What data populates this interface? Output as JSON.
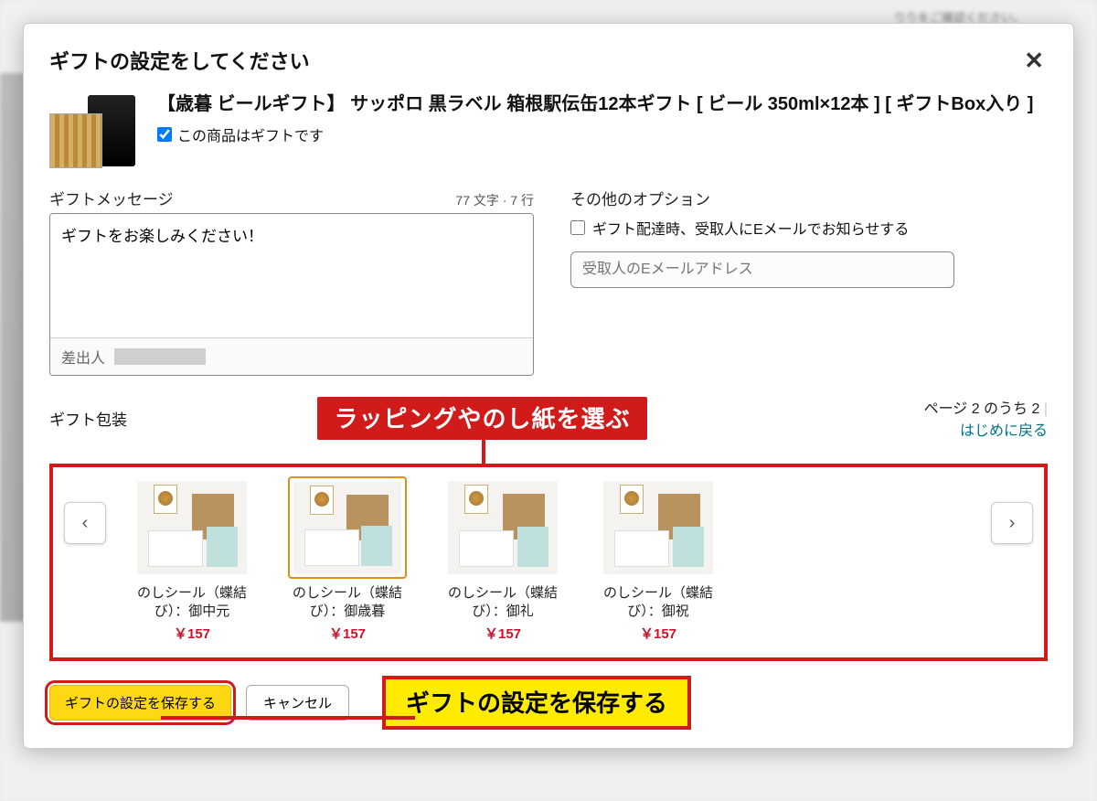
{
  "modal": {
    "title": "ギフトの設定をしてください",
    "close_symbol": "✕"
  },
  "product": {
    "title": "【歳暮 ビールギフト】 サッポロ 黒ラベル 箱根駅伝缶12本ギフト [ ビール 350ml×12本 ] [ ギフトBox入り ]",
    "gift_checkbox_label": "この商品はギフトです",
    "gift_checked": true
  },
  "message": {
    "section_label": "ギフトメッセージ",
    "char_count": "77 文字 · 7 行",
    "value": "ギフトをお楽しみください！",
    "sender_label": "差出人"
  },
  "options": {
    "section_label": "その他のオプション",
    "notify_label": "ギフト配達時、受取人にEメールでお知らせする",
    "email_placeholder": "受取人のEメールアドレス"
  },
  "wrapping": {
    "section_label": "ギフト包装",
    "annotation_select": "ラッピングやのし紙を選ぶ",
    "pager_text": "ページ 2 のうち 2 ",
    "pager_link": "はじめに戻る",
    "prev": "‹",
    "next": "›",
    "items": [
      {
        "name": "のしシール（蝶結び）：御中元",
        "price": "￥157",
        "selected": false
      },
      {
        "name": "のしシール（蝶結び）：御歳暮",
        "price": "￥157",
        "selected": true
      },
      {
        "name": "のしシール（蝶結び）：御礼",
        "price": "￥157",
        "selected": false
      },
      {
        "name": "のしシール（蝶結び）：御祝",
        "price": "￥157",
        "selected": false
      }
    ]
  },
  "buttons": {
    "save": "ギフトの設定を保存する",
    "cancel": "キャンセル",
    "annotation_save": "ギフトの設定を保存する"
  }
}
